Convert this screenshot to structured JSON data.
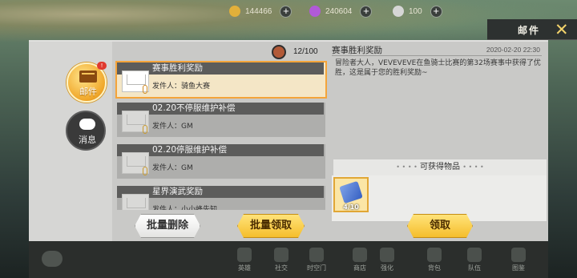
{
  "currencies": [
    {
      "icon": "gold-coin-icon",
      "value": "144466",
      "color": "#e2b03a"
    },
    {
      "icon": "purple-gem-icon",
      "value": "240604",
      "color": "#b15ad8"
    },
    {
      "icon": "silver-coin-icon",
      "value": "100",
      "color": "#d6d6d6"
    }
  ],
  "window": {
    "title": "邮件",
    "close_glyph": "✕"
  },
  "sidebar": {
    "mail_label": "邮件",
    "mail_badge": "!",
    "message_label": "消息"
  },
  "mail_count": "12/100",
  "mails": [
    {
      "subject": "赛事胜利奖励",
      "sender": "发件人：骑鱼大赛"
    },
    {
      "subject": "02.20不停服维护补偿",
      "sender": "发件人：GM"
    },
    {
      "subject": "02.20停服维护补偿",
      "sender": "发件人：GM"
    },
    {
      "subject": "星界演武奖励",
      "sender": "发件人：小小蜂先知"
    }
  ],
  "actions": {
    "batch_delete": "批量删除",
    "batch_claim": "批量领取",
    "claim": "领取"
  },
  "detail": {
    "title": "赛事胜利奖励",
    "date": "2020-02-20 22:30",
    "body": "冒险者大人，VEVEVEVE在鱼骑士比赛的第32场赛事中获得了优胜，这是属于您的胜利奖励~",
    "rewards_header": "可获得物品",
    "reward_quantity": "4/10"
  },
  "bottom_nav": [
    "英雄",
    "社交",
    "时空门",
    "商店",
    "强化",
    "背包",
    "队伍",
    "图鉴"
  ]
}
